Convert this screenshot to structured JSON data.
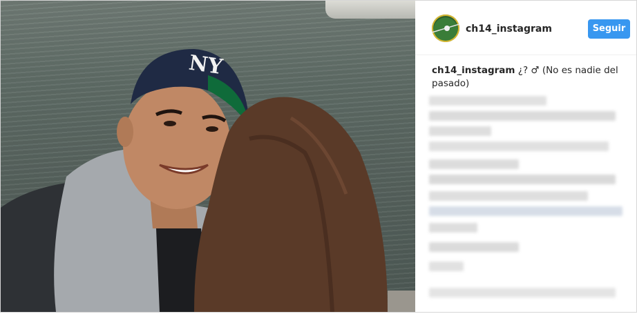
{
  "post": {
    "username": "ch14_instagram",
    "follow_label": "Seguir",
    "caption_username": "ch14_instagram",
    "caption_text": "¿? ♂ (No es nadie del pasado)"
  },
  "colors": {
    "follow_button": "#3897f0",
    "text": "#262626"
  }
}
